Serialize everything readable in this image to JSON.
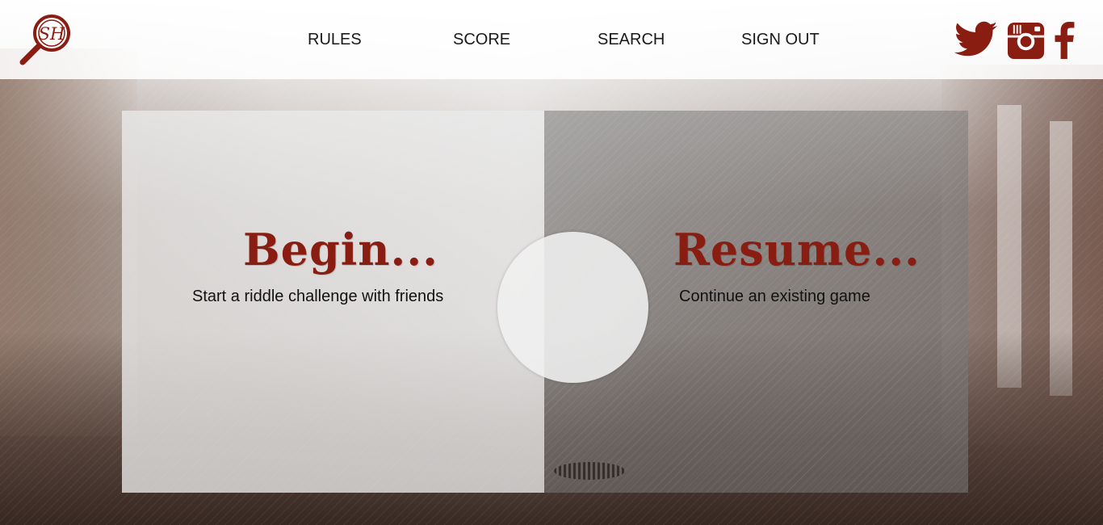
{
  "header": {
    "logo_text": "SH",
    "nav": [
      {
        "label": "RULES"
      },
      {
        "label": "SCORE"
      },
      {
        "label": "SEARCH"
      },
      {
        "label": "SIGN OUT"
      }
    ],
    "social": [
      {
        "icon": "twitter-icon"
      },
      {
        "icon": "instagram-icon"
      },
      {
        "icon": "facebook-icon"
      }
    ]
  },
  "cards": {
    "begin": {
      "title": "Begin...",
      "subtitle": "Start a riddle challenge with friends"
    },
    "resume": {
      "title": "Resume...",
      "subtitle": "Continue an existing game"
    }
  },
  "colors": {
    "accent": "#8a1d12",
    "header_bg": "#ffffff",
    "nav_text": "#1a1a1a"
  }
}
